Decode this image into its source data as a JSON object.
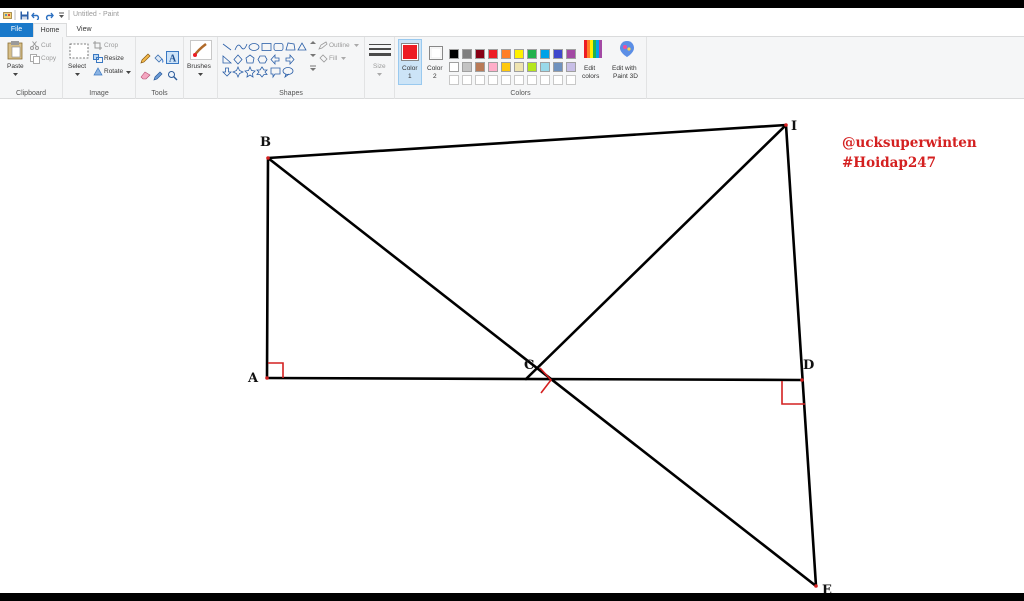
{
  "window": {
    "title": "Untitled - Paint"
  },
  "tabs": {
    "file": "File",
    "home": "Home",
    "view": "View"
  },
  "ribbon": {
    "clipboard": {
      "paste": "Paste",
      "cut": "Cut",
      "copy": "Copy",
      "label": "Clipboard"
    },
    "image": {
      "select": "Select",
      "crop": "Crop",
      "resize": "Resize",
      "rotate": "Rotate",
      "label": "Image"
    },
    "tools": {
      "label": "Tools"
    },
    "brushes": {
      "label": "Brushes"
    },
    "shapes": {
      "outline": "Outline",
      "fill": "Fill",
      "label": "Shapes"
    },
    "size": {
      "label": "Size"
    },
    "colors": {
      "color1_label": "Color",
      "color1_num": "1",
      "color2_label": "Color",
      "color2_num": "2",
      "edit_colors_line1": "Edit",
      "edit_colors_line2": "colors",
      "paint3d_line1": "Edit with",
      "paint3d_line2": "Paint 3D",
      "label": "Colors",
      "color1_value": "#ed1c24",
      "color2_value": "#ffffff",
      "palette_row1": [
        "#000000",
        "#7f7f7f",
        "#880015",
        "#ed1c24",
        "#ff7f27",
        "#fff200",
        "#22b14c",
        "#00a2e8",
        "#3f48cc",
        "#a349a4"
      ],
      "palette_row2": [
        "#ffffff",
        "#c3c3c3",
        "#b97a57",
        "#ffaec9",
        "#ffc90e",
        "#efe4b0",
        "#b5e61d",
        "#99d9ea",
        "#7092be",
        "#c8bfe7"
      ]
    }
  },
  "canvas": {
    "points": {
      "B": "B",
      "I": "I",
      "A": "A",
      "C": "C",
      "D": "D",
      "E": "E"
    },
    "watermark_line1": "@ucksuperwinten",
    "watermark_line2": "#Hoidap247"
  },
  "colors": {
    "accent": "#1979ca",
    "marker_red": "#d42020"
  }
}
